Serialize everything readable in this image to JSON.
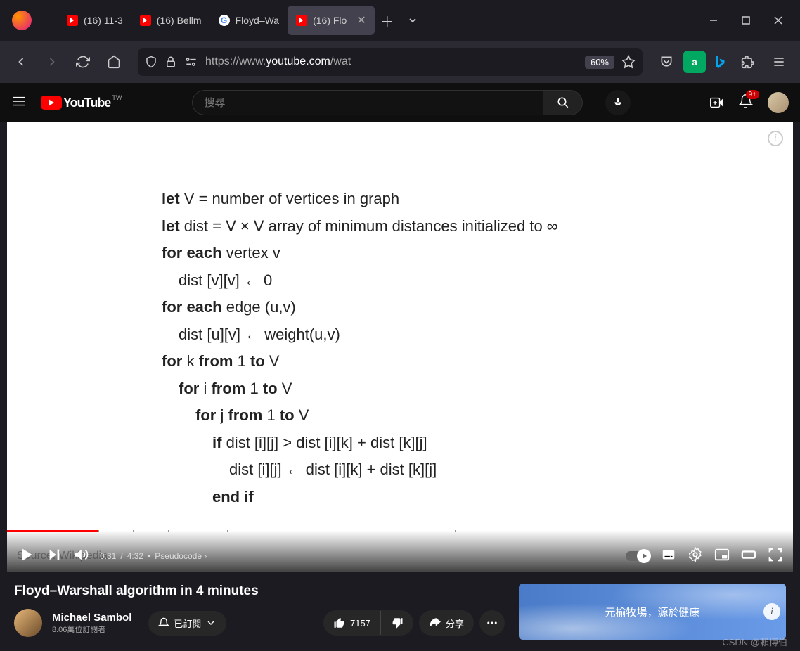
{
  "browser": {
    "tabs": [
      {
        "label": "(16) 11-3"
      },
      {
        "label": "(16) Bellm"
      },
      {
        "label": "Floyd–Wa"
      },
      {
        "label": "(16) Flo"
      }
    ],
    "url_prefix": "https://www.",
    "url_host": "youtube.com",
    "url_suffix": "/wat",
    "zoom": "60%"
  },
  "yt": {
    "logo": "YouTube",
    "logo_locale": "TW",
    "search_placeholder": "搜尋",
    "notif_badge": "9+"
  },
  "video": {
    "pseudocode": {
      "l1a": "let",
      "l1b": " V = number of vertices in graph",
      "l2a": "let",
      "l2b": " dist = V × V array of minimum distances initialized to ∞",
      "l3a": "for each",
      "l3b": " vertex v",
      "l4": "dist [v][v] ← 0",
      "l5a": "for each",
      "l5b": " edge (u,v)",
      "l6": "dist [u][v] ← weight(u,v)",
      "l7a": "for",
      "l7b": " k ",
      "l7c": "from",
      "l7d": " 1 ",
      "l7e": "to",
      "l7f": " V",
      "l8a": "for",
      "l8b": " i ",
      "l8c": "from",
      "l8d": " 1 ",
      "l8e": "to",
      "l8f": " V",
      "l9a": "for",
      "l9b": " j ",
      "l9c": "from",
      "l9d": " 1 ",
      "l9e": "to",
      "l9f": " V",
      "l10a": "if",
      "l10b": " dist [i][j] > dist [i][k] + dist [k][j]",
      "l11": "dist [i][j] ← dist [i][k] + dist [k][j]",
      "l12": "end if"
    },
    "source": "Source: Wikipedia",
    "time_current": "0:31",
    "time_sep": "/",
    "time_total": "4:32",
    "chapter_bullet": "•",
    "chapter": "Pseudocode",
    "title": "Floyd–Warshall algorithm in 4 minutes",
    "channel": "Michael Sambol",
    "subs": "8.06萬位訂閱者",
    "subscribed": "已訂閱",
    "likes": "7157",
    "share": "分享"
  },
  "ad": {
    "text": "元榆牧場，源於健康"
  },
  "watermark": "CSDN @賴博伯"
}
